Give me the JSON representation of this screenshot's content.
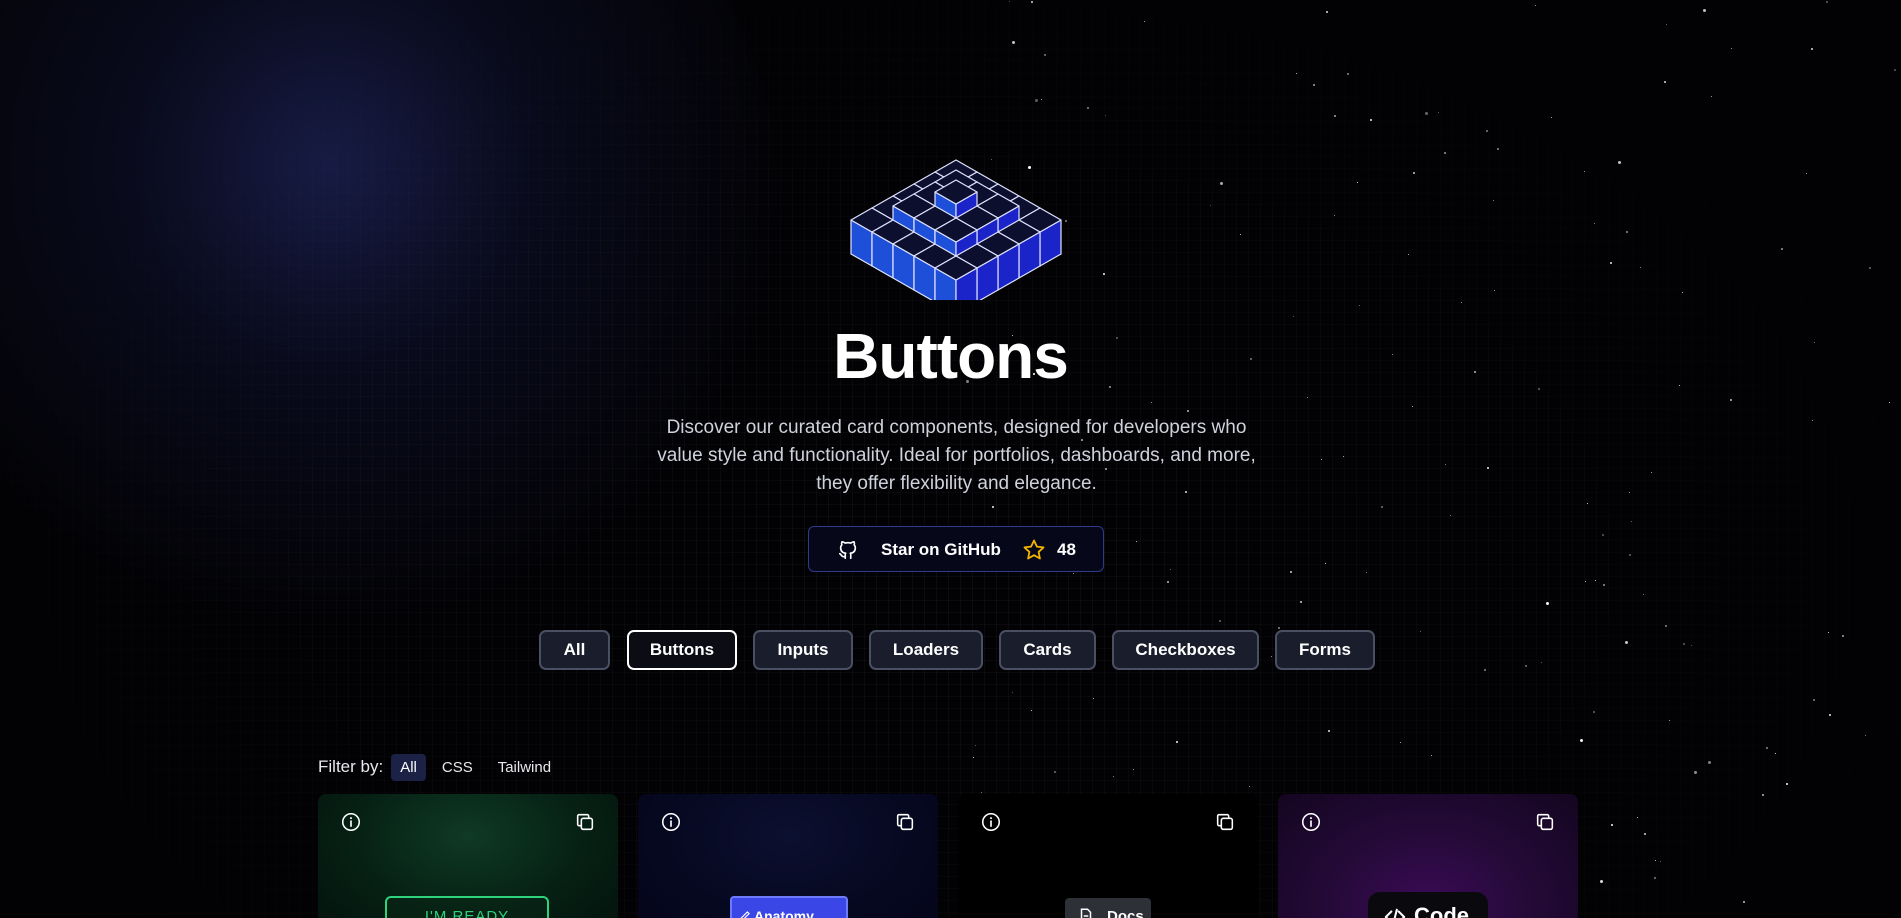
{
  "hero": {
    "title": "Buttons",
    "description": "Discover our curated card components, designed for developers who value style and functionality. Ideal for portfolios, dashboards, and more, they offer flexibility and elegance."
  },
  "github": {
    "label": "Star on GitHub",
    "count": "48",
    "icon": "github-icon",
    "star_icon": "star-icon"
  },
  "categories": {
    "items": [
      {
        "label": "All",
        "active": false
      },
      {
        "label": "Buttons",
        "active": true
      },
      {
        "label": "Inputs",
        "active": false
      },
      {
        "label": "Loaders",
        "active": false
      },
      {
        "label": "Cards",
        "active": false
      },
      {
        "label": "Checkboxes",
        "active": false
      },
      {
        "label": "Forms",
        "active": false
      }
    ]
  },
  "filter": {
    "label": "Filter by:",
    "options": [
      {
        "label": "All",
        "active": true
      },
      {
        "label": "CSS",
        "active": false
      },
      {
        "label": "Tailwind",
        "active": false
      }
    ]
  },
  "cards": [
    {
      "demo_label": "I'M READY",
      "accent": "#2ed27a"
    },
    {
      "demo_label": "Anatomy",
      "accent": "#3a47e6"
    },
    {
      "demo_label": "Docs",
      "accent": "#2e3038"
    },
    {
      "demo_label": "Code",
      "accent": "#3b0a56"
    }
  ],
  "colors": {
    "background": "#020204",
    "accent_blue": "#2e3a8c",
    "star_gold": "#f5b400"
  }
}
